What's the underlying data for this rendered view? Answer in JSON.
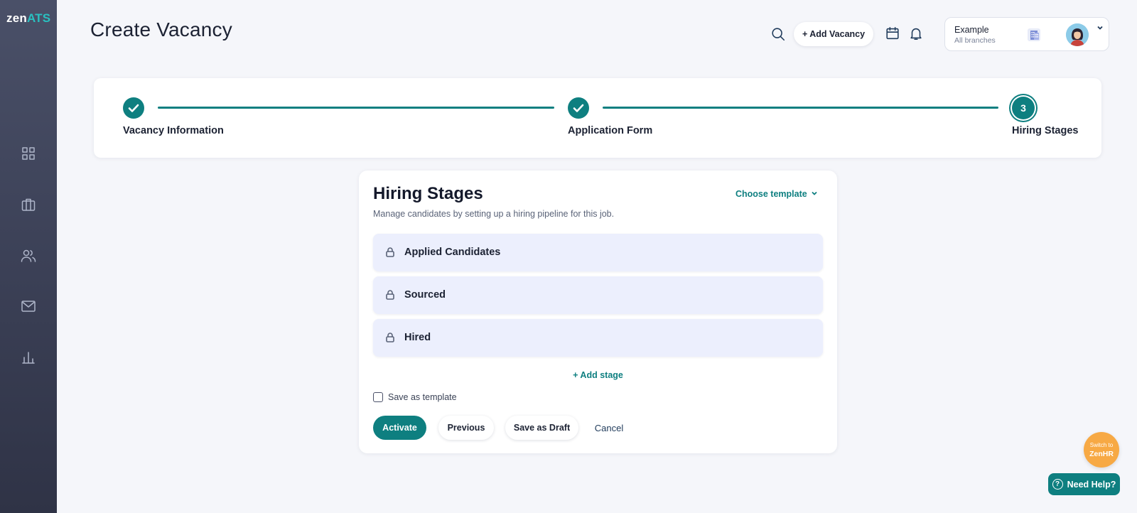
{
  "brand": {
    "logo_part1": "zen",
    "logo_part2": "ATS"
  },
  "sidebar": {
    "items": [
      {
        "icon": "dashboard-icon"
      },
      {
        "icon": "briefcase-icon"
      },
      {
        "icon": "users-icon"
      },
      {
        "icon": "mail-icon"
      },
      {
        "icon": "bar-chart-icon"
      }
    ]
  },
  "header": {
    "title": "Create Vacancy",
    "add_vacancy_label": "+ Add Vacancy",
    "company": {
      "name": "Example",
      "branches": "All branches"
    }
  },
  "stepper": {
    "steps": [
      {
        "label": "Vacancy Information",
        "status": "done"
      },
      {
        "label": "Application Form",
        "status": "done"
      },
      {
        "label": "Hiring Stages",
        "status": "current",
        "number": "3"
      }
    ]
  },
  "hiring_stages": {
    "title": "Hiring Stages",
    "subtitle": "Manage candidates by setting up a hiring pipeline for this job.",
    "choose_template_label": "Choose template",
    "stages": [
      {
        "name": "Applied Candidates",
        "locked": true
      },
      {
        "name": "Sourced",
        "locked": true
      },
      {
        "name": "Hired",
        "locked": true
      }
    ],
    "add_stage_label": "+ Add stage",
    "save_as_template_label": "Save as template",
    "save_as_template_checked": false
  },
  "actions": {
    "activate_label": "Activate",
    "previous_label": "Previous",
    "save_draft_label": "Save as Draft",
    "cancel_label": "Cancel"
  },
  "floating": {
    "switch_line1": "Switch to",
    "switch_line2": "ZenHR",
    "help_label": "Need Help?"
  },
  "colors": {
    "accent": "#0e7f80",
    "sidebar": "#3c4157",
    "stage_bg": "#eceffd",
    "switch_button": "#f7a944"
  }
}
